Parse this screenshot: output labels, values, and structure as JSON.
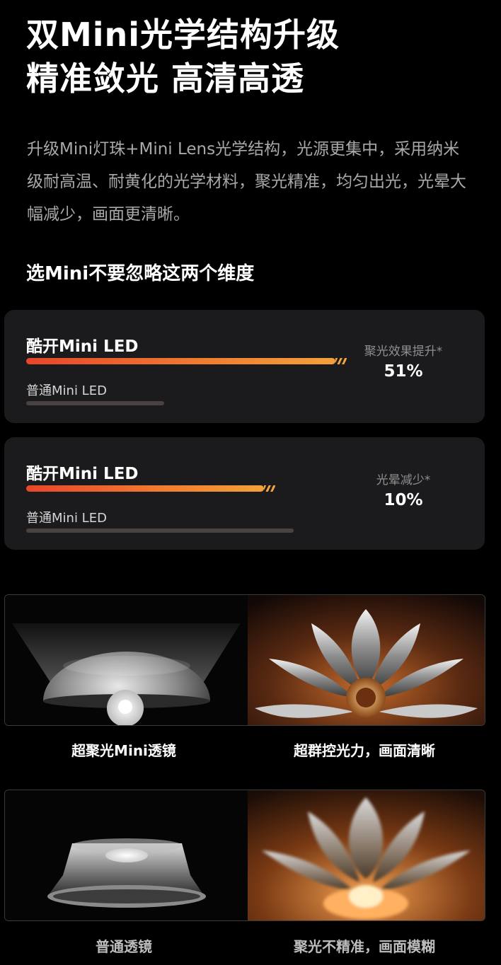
{
  "header": {
    "title_line1": "双Mini光学结构升级",
    "title_line2": "精准敛光 高清高透",
    "description": "升级Mini灯珠+Mini Lens光学结构，光源更集中，采用纳米级耐高温、耐黄化的光学材料，聚光精准，均匀出光，光晕大幅减少，画面更清晰。"
  },
  "section": {
    "heading": "选Mini不要忽略这两个维度"
  },
  "comparisons": [
    {
      "main_label": "酷开Mini LED",
      "sub_label": "普通Mini LED",
      "main_level": 0.74,
      "sub_level": 0.33,
      "stat_label": "聚光效果提升*",
      "stat_value": "51%"
    },
    {
      "main_label": "酷开Mini LED",
      "sub_label": "普通Mini LED",
      "main_level": 0.57,
      "sub_level": 0.64,
      "stat_label": "光晕减少*",
      "stat_value": "10%"
    }
  ],
  "panels": [
    {
      "left_caption": "超聚光Mini透镜",
      "right_caption": "超群控光力，画面清晰",
      "caption_color": "#ffffff"
    },
    {
      "left_caption": "普通透镜",
      "right_caption": "聚光不精准，画面模糊",
      "caption_color": "#bdbdbd"
    }
  ],
  "colors": {
    "background": "#000000",
    "card": "#1b1b1d",
    "accent_start": "#e8462a",
    "accent_end": "#f4a13a",
    "sub_bar": "#4a4240"
  }
}
